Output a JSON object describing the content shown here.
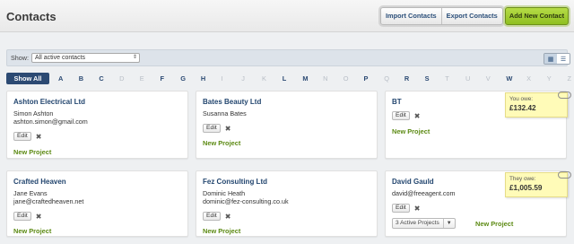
{
  "header": {
    "title": "Contacts",
    "import_label": "Import Contacts",
    "export_label": "Export Contacts",
    "add_label": "Add New Contact"
  },
  "filter": {
    "show_label": "Show:",
    "selected": "All active contacts",
    "view_modes": [
      "grid-view-icon",
      "list-view-icon"
    ],
    "active_view": "grid"
  },
  "alphabet": {
    "show_all": "Show All",
    "letters": [
      {
        "l": "A",
        "active": true
      },
      {
        "l": "B",
        "active": true
      },
      {
        "l": "C",
        "active": true
      },
      {
        "l": "D",
        "active": false
      },
      {
        "l": "E",
        "active": false
      },
      {
        "l": "F",
        "active": true
      },
      {
        "l": "G",
        "active": true
      },
      {
        "l": "H",
        "active": true
      },
      {
        "l": "I",
        "active": false
      },
      {
        "l": "J",
        "active": false
      },
      {
        "l": "K",
        "active": false
      },
      {
        "l": "L",
        "active": true
      },
      {
        "l": "M",
        "active": true
      },
      {
        "l": "N",
        "active": false
      },
      {
        "l": "O",
        "active": false
      },
      {
        "l": "P",
        "active": true
      },
      {
        "l": "Q",
        "active": false
      },
      {
        "l": "R",
        "active": true
      },
      {
        "l": "S",
        "active": true
      },
      {
        "l": "T",
        "active": false
      },
      {
        "l": "U",
        "active": false
      },
      {
        "l": "V",
        "active": false
      },
      {
        "l": "W",
        "active": true
      },
      {
        "l": "X",
        "active": false
      },
      {
        "l": "Y",
        "active": false
      },
      {
        "l": "Z",
        "active": false
      }
    ]
  },
  "common": {
    "edit": "Edit",
    "delete_glyph": "✖",
    "new_project": "New Project"
  },
  "contacts": [
    {
      "name": "Ashton Electrical Ltd",
      "person": "Simon Ashton",
      "email": "ashton.simon@gmail.com"
    },
    {
      "name": "Bates Beauty Ltd",
      "person": "Susanna Bates",
      "email": ""
    },
    {
      "name": "BT",
      "person": "",
      "email": "",
      "note_label": "You owe:",
      "note_amount": "£132.42"
    },
    {
      "name": "Crafted Heaven",
      "person": "Jane Evans",
      "email": "jane@craftedheaven.net"
    },
    {
      "name": "Fez Consulting Ltd",
      "person": "Dominic Heath",
      "email": "dominic@fez-consulting.co.uk"
    },
    {
      "name": "David Gauld",
      "person": "",
      "email": "david@freeagent.com",
      "note_label": "They owe:",
      "note_amount": "£1,005.59",
      "projects": "3 Active Projects"
    }
  ],
  "colors": {
    "accent_blue": "#2c4a73",
    "link_green": "#5c8a13",
    "add_button": "#9ccb2c",
    "note_yellow": "#fffbb8"
  }
}
